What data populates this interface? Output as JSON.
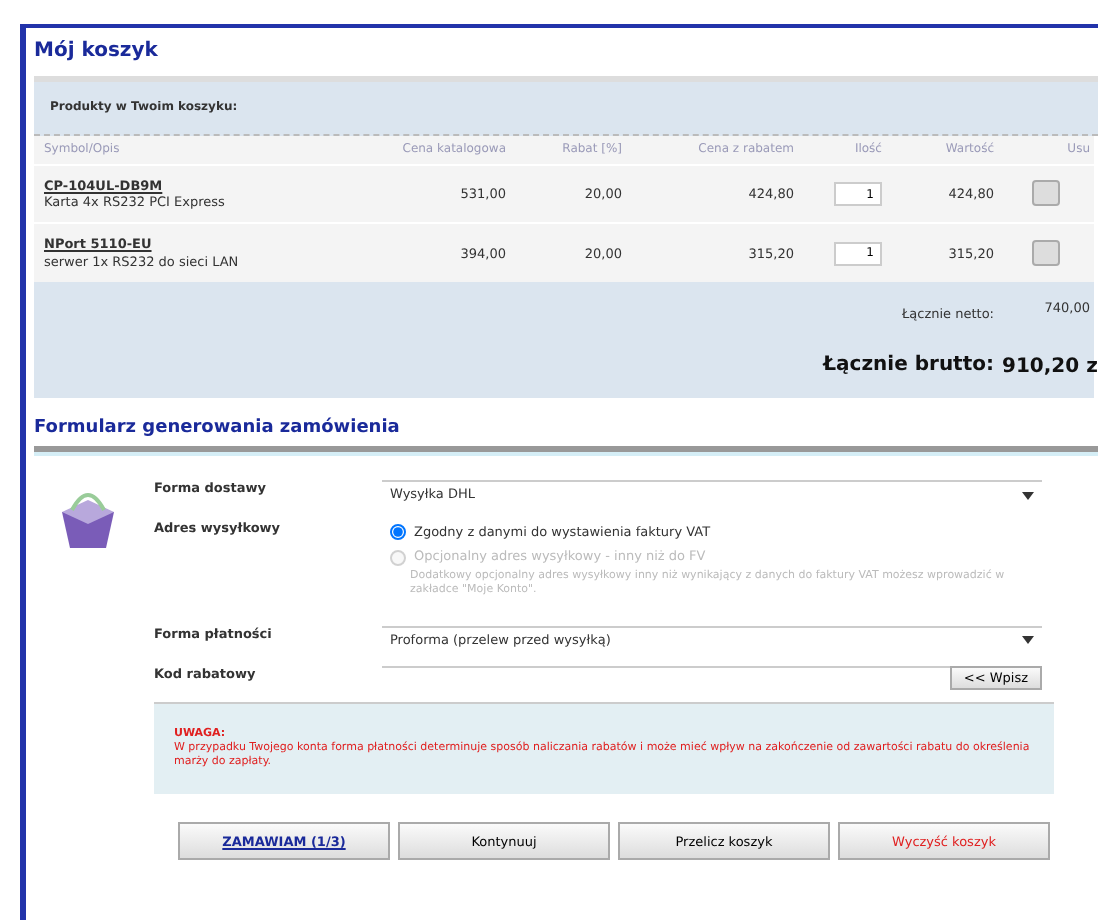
{
  "cart": {
    "title": "Mój koszyk",
    "subtitle": "Produkty w Twoim koszyku:",
    "columns": [
      "Symbol/Opis",
      "Cena katalogowa",
      "Rabat [%]",
      "Cena z rabatem",
      "Ilość",
      "Wartość",
      "Usu"
    ],
    "rows": [
      {
        "symbol": "CP-104UL-DB9M",
        "description": "Karta 4x RS232 PCI Express",
        "list_price": "531,00",
        "discount": "20,00",
        "price": "424,80",
        "quantity": "1",
        "value": "424,80"
      },
      {
        "symbol": "NPort 5110-EU",
        "description": "serwer 1x RS232 do sieci LAN",
        "list_price": "394,00",
        "discount": "20,00",
        "price": "315,20",
        "quantity": "1",
        "value": "315,20"
      }
    ],
    "net_label": "Łącznie netto:",
    "net_value": "740,00",
    "gross_label": "Łącznie brutto:",
    "gross_value": "910,20 z"
  },
  "order_form": {
    "title": "Formularz generowania zamówienia",
    "delivery": {
      "label": "Forma dostawy",
      "value": "Wysyłka DHL"
    },
    "address": {
      "label": "Adres wysyłkowy",
      "options": [
        {
          "label": "Zgodny z danymi do wystawienia faktury VAT",
          "selected": true,
          "disabled": false
        },
        {
          "label": "Opcjonalny adres wysyłkowy - inny niż do FV",
          "selected": false,
          "disabled": true
        }
      ],
      "note": "Dodatkowy opcjonalny adres wysyłkowy inny niż wynikający z danych do faktury VAT możesz wprowadzić w zakładce \"Moje Konto\"."
    },
    "payment": {
      "label": "Forma płatności",
      "value": "Proforma (przelew przed wysyłką)"
    },
    "coupon": {
      "label": "Kod rabatowy",
      "button": "<< Wpisz"
    },
    "warning": {
      "title": "UWAGA:",
      "text": "W przypadku Twojego konta forma płatności determinuje sposób naliczania rabatów i może mieć wpływ na zakończenie od zawartości rabatu do określenia marży do zapłaty."
    },
    "buttons": [
      {
        "label": "ZAMAWIAM (1/3)",
        "kind": "primary"
      },
      {
        "label": "Kontynuuj",
        "kind": "normal"
      },
      {
        "label": "Przelicz koszyk",
        "kind": "normal"
      },
      {
        "label": "Wyczyść koszyk",
        "kind": "danger"
      }
    ]
  }
}
